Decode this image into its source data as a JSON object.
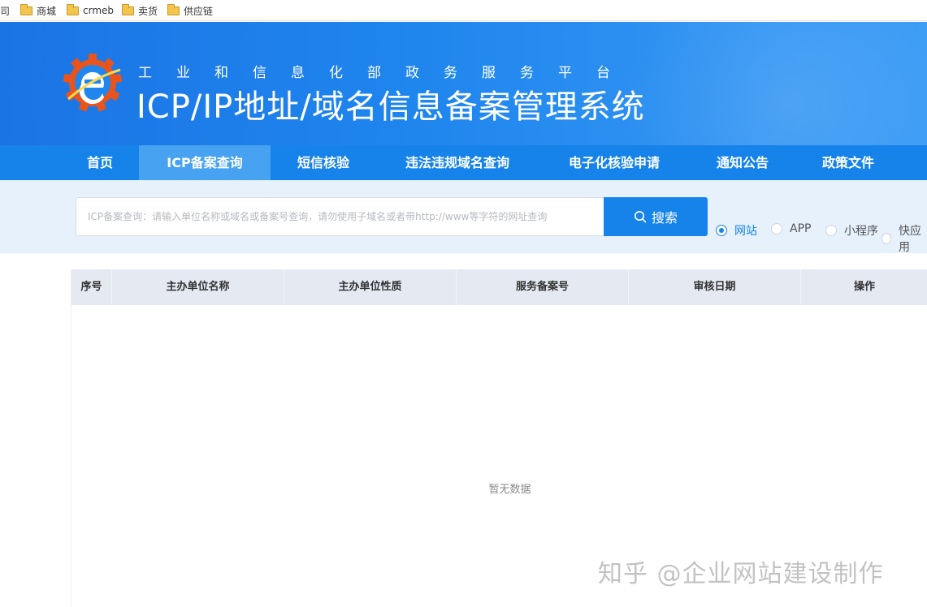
{
  "bookmarks": {
    "cut_label": "司",
    "items": [
      "商城",
      "crmeb",
      "卖货",
      "供应链"
    ]
  },
  "header": {
    "subtitle": "工业和信息化部政务服务平台",
    "title": "ICP/IP地址/域名信息备案管理系统"
  },
  "nav": {
    "items": [
      "首页",
      "ICP备案查询",
      "短信核验",
      "违法违规域名查询",
      "电子化核验申请",
      "通知公告",
      "政策文件"
    ],
    "active": "ICP备案查询"
  },
  "search": {
    "placeholder": "ICP备案查询：请输入单位名称或域名或备案号查询，请勿使用子域名或者带http://www等字符的网址查询",
    "button_label": "搜索",
    "types": [
      "网站",
      "APP",
      "小程序",
      "快应用"
    ],
    "selected_type": "网站"
  },
  "table": {
    "columns": [
      "序号",
      "主办单位名称",
      "主办单位性质",
      "服务备案号",
      "审核日期",
      "操作"
    ],
    "rows": [],
    "empty_text": "暂无数据"
  },
  "watermark": "知乎 @企业网站建设制作",
  "colors": {
    "primary": "#1683ea",
    "nav_active": "#47a2f1",
    "search_band": "#e6f1fc",
    "table_header": "#e5e9f2"
  }
}
